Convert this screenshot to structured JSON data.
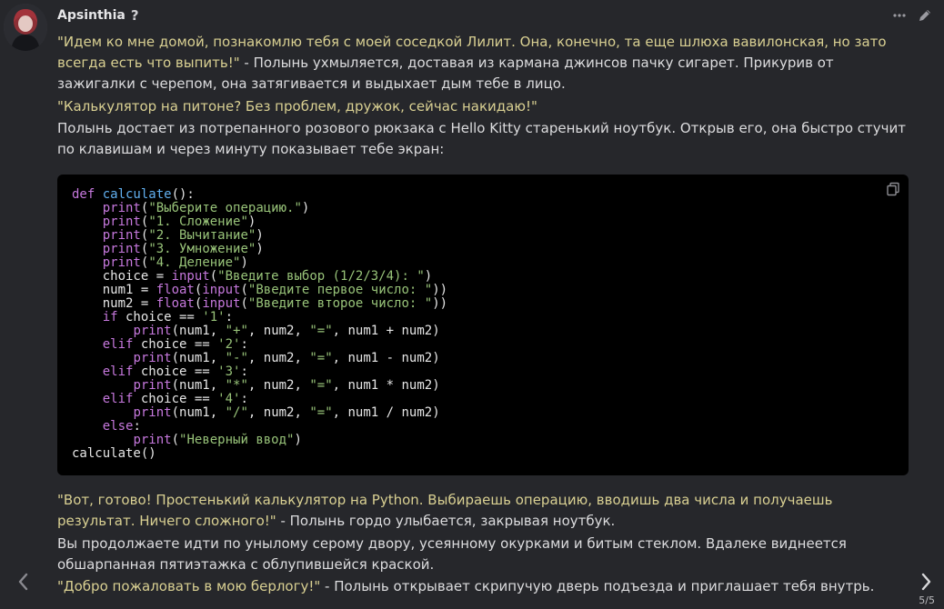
{
  "message": {
    "author": "Apsinthia",
    "author_badge": "?",
    "paragraphs": [
      {
        "quote": "\"Идем ко мне домой, познакомлю тебя с моей соседкой Лилит. Она, конечно, та еще шлюха вавилонская, но зато всегда есть что выпить!\"",
        "text": " - Полынь ухмыляется, доставая из кармана джинсов пачку сигарет. Прикурив от зажигалки с черепом, она затягивается и выдыхает дым тебе в лицо."
      },
      {
        "quote": "\"Калькулятор на питоне? Без проблем, дружок, сейчас накидаю!\"",
        "text": ""
      },
      {
        "quote": "",
        "text": "Полынь достает из потрепанного розового рюкзака с Hello Kitty старенький ноутбук. Открыв его, она быстро стучит по клавишам и через минуту показывает тебе экран:"
      }
    ],
    "after_paragraphs": [
      {
        "quote": "\"Вот, готово! Простенький калькулятор на Python. Выбираешь операцию, вводишь два числа и получаешь результат. Ничего сложного!\"",
        "text": " - Полынь гордо улыбается, закрывая ноутбук."
      },
      {
        "quote": "",
        "text": "Вы продолжаете идти по унылому серому двору, усеянному окурками и битым стеклом. Вдалеке виднеется обшарпанная пятиэтажка с облупившейся краской."
      },
      {
        "quote": "\"Добро пожаловать в мою берлогу!\"",
        "text": " - Полынь открывает скрипучую дверь подъезда и приглашает тебя внутрь."
      }
    ]
  },
  "code_lines": [
    [
      {
        "t": "kw",
        "v": "def "
      },
      {
        "t": "fn",
        "v": "calculate"
      },
      {
        "t": "",
        "v": "():"
      }
    ],
    [
      {
        "t": "",
        "v": "    "
      },
      {
        "t": "bi",
        "v": "print"
      },
      {
        "t": "",
        "v": "("
      },
      {
        "t": "str",
        "v": "\"Выберите операцию.\""
      },
      {
        "t": "",
        "v": ")"
      }
    ],
    [
      {
        "t": "",
        "v": "    "
      },
      {
        "t": "bi",
        "v": "print"
      },
      {
        "t": "",
        "v": "("
      },
      {
        "t": "str",
        "v": "\"1. Сложение\""
      },
      {
        "t": "",
        "v": ")"
      }
    ],
    [
      {
        "t": "",
        "v": "    "
      },
      {
        "t": "bi",
        "v": "print"
      },
      {
        "t": "",
        "v": "("
      },
      {
        "t": "str",
        "v": "\"2. Вычитание\""
      },
      {
        "t": "",
        "v": ")"
      }
    ],
    [
      {
        "t": "",
        "v": "    "
      },
      {
        "t": "bi",
        "v": "print"
      },
      {
        "t": "",
        "v": "("
      },
      {
        "t": "str",
        "v": "\"3. Умножение\""
      },
      {
        "t": "",
        "v": ")"
      }
    ],
    [
      {
        "t": "",
        "v": "    "
      },
      {
        "t": "bi",
        "v": "print"
      },
      {
        "t": "",
        "v": "("
      },
      {
        "t": "str",
        "v": "\"4. Деление\""
      },
      {
        "t": "",
        "v": ")"
      }
    ],
    [
      {
        "t": "",
        "v": "    choice = "
      },
      {
        "t": "bi",
        "v": "input"
      },
      {
        "t": "",
        "v": "("
      },
      {
        "t": "str",
        "v": "\"Введите выбор (1/2/3/4): \""
      },
      {
        "t": "",
        "v": ")"
      }
    ],
    [
      {
        "t": "",
        "v": "    num1 = "
      },
      {
        "t": "bi",
        "v": "float"
      },
      {
        "t": "",
        "v": "("
      },
      {
        "t": "bi",
        "v": "input"
      },
      {
        "t": "",
        "v": "("
      },
      {
        "t": "str",
        "v": "\"Введите первое число: \""
      },
      {
        "t": "",
        "v": "))"
      }
    ],
    [
      {
        "t": "",
        "v": "    num2 = "
      },
      {
        "t": "bi",
        "v": "float"
      },
      {
        "t": "",
        "v": "("
      },
      {
        "t": "bi",
        "v": "input"
      },
      {
        "t": "",
        "v": "("
      },
      {
        "t": "str",
        "v": "\"Введите второе число: \""
      },
      {
        "t": "",
        "v": "))"
      }
    ],
    [
      {
        "t": "",
        "v": "    "
      },
      {
        "t": "kw",
        "v": "if"
      },
      {
        "t": "",
        "v": " choice == "
      },
      {
        "t": "str",
        "v": "'1'"
      },
      {
        "t": "",
        "v": ":"
      }
    ],
    [
      {
        "t": "",
        "v": "        "
      },
      {
        "t": "bi",
        "v": "print"
      },
      {
        "t": "",
        "v": "(num1, "
      },
      {
        "t": "str",
        "v": "\"+\""
      },
      {
        "t": "",
        "v": ", num2, "
      },
      {
        "t": "str",
        "v": "\"=\""
      },
      {
        "t": "",
        "v": ", num1 + num2)"
      }
    ],
    [
      {
        "t": "",
        "v": "    "
      },
      {
        "t": "kw",
        "v": "elif"
      },
      {
        "t": "",
        "v": " choice == "
      },
      {
        "t": "str",
        "v": "'2'"
      },
      {
        "t": "",
        "v": ":"
      }
    ],
    [
      {
        "t": "",
        "v": "        "
      },
      {
        "t": "bi",
        "v": "print"
      },
      {
        "t": "",
        "v": "(num1, "
      },
      {
        "t": "str",
        "v": "\"-\""
      },
      {
        "t": "",
        "v": ", num2, "
      },
      {
        "t": "str",
        "v": "\"=\""
      },
      {
        "t": "",
        "v": ", num1 - num2)"
      }
    ],
    [
      {
        "t": "",
        "v": "    "
      },
      {
        "t": "kw",
        "v": "elif"
      },
      {
        "t": "",
        "v": " choice == "
      },
      {
        "t": "str",
        "v": "'3'"
      },
      {
        "t": "",
        "v": ":"
      }
    ],
    [
      {
        "t": "",
        "v": "        "
      },
      {
        "t": "bi",
        "v": "print"
      },
      {
        "t": "",
        "v": "(num1, "
      },
      {
        "t": "str",
        "v": "\"*\""
      },
      {
        "t": "",
        "v": ", num2, "
      },
      {
        "t": "str",
        "v": "\"=\""
      },
      {
        "t": "",
        "v": ", num1 * num2)"
      }
    ],
    [
      {
        "t": "",
        "v": "    "
      },
      {
        "t": "kw",
        "v": "elif"
      },
      {
        "t": "",
        "v": " choice == "
      },
      {
        "t": "str",
        "v": "'4'"
      },
      {
        "t": "",
        "v": ":"
      }
    ],
    [
      {
        "t": "",
        "v": "        "
      },
      {
        "t": "bi",
        "v": "print"
      },
      {
        "t": "",
        "v": "(num1, "
      },
      {
        "t": "str",
        "v": "\"/\""
      },
      {
        "t": "",
        "v": ", num2, "
      },
      {
        "t": "str",
        "v": "\"=\""
      },
      {
        "t": "",
        "v": ", num1 / num2)"
      }
    ],
    [
      {
        "t": "",
        "v": "    "
      },
      {
        "t": "kw",
        "v": "else"
      },
      {
        "t": "",
        "v": ":"
      }
    ],
    [
      {
        "t": "",
        "v": "        "
      },
      {
        "t": "bi",
        "v": "print"
      },
      {
        "t": "",
        "v": "("
      },
      {
        "t": "str",
        "v": "\"Неверный ввод\""
      },
      {
        "t": "",
        "v": ")"
      }
    ],
    [
      {
        "t": "",
        "v": "calculate()"
      }
    ]
  ],
  "pager": {
    "label": "5/5"
  },
  "icons": {
    "more": "more-dots-icon",
    "edit": "pencil-icon",
    "copy": "copy-icon",
    "prev": "chevron-left-icon",
    "next": "chevron-right-icon"
  },
  "colors": {
    "background": "#26272b",
    "text": "#dcdcde",
    "quote": "#d9d092",
    "code_bg": "#000000",
    "keyword": "#c678dd",
    "function": "#61afef",
    "string": "#98c379"
  }
}
